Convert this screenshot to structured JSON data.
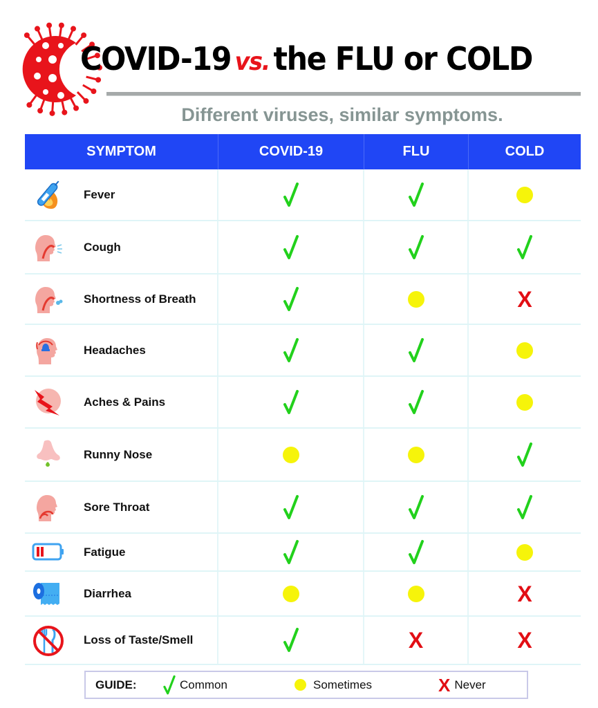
{
  "header": {
    "title_part1": "COVID-19",
    "title_vs": "vs.",
    "title_part2": "the FLU or COLD",
    "subtitle": "Different viruses, similar symptoms.",
    "logo_icon": "coronavirus-icon"
  },
  "colors": {
    "header_bg": "#2046f5",
    "common": "#22d11c",
    "sometimes": "#f6f40a",
    "never": "#e20e14",
    "virus_red": "#e8141b",
    "subtitle_gray": "#869593"
  },
  "table": {
    "columns": [
      "SYMPTOM",
      "COVID-19",
      "FLU",
      "COLD"
    ],
    "rows": [
      {
        "symptom": "Fever",
        "icon": "thermometer-fire-icon",
        "covid": "common",
        "flu": "common",
        "cold": "sometimes"
      },
      {
        "symptom": "Cough",
        "icon": "cough-head-icon",
        "covid": "common",
        "flu": "common",
        "cold": "common"
      },
      {
        "symptom": "Shortness of Breath",
        "icon": "breath-head-icon",
        "covid": "common",
        "flu": "sometimes",
        "cold": "never"
      },
      {
        "symptom": "Headaches",
        "icon": "headache-icon",
        "covid": "common",
        "flu": "common",
        "cold": "sometimes"
      },
      {
        "symptom": "Aches & Pains",
        "icon": "pain-bolt-icon",
        "covid": "common",
        "flu": "common",
        "cold": "sometimes"
      },
      {
        "symptom": "Runny Nose",
        "icon": "nose-drip-icon",
        "covid": "sometimes",
        "flu": "sometimes",
        "cold": "common"
      },
      {
        "symptom": "Sore Throat",
        "icon": "sore-throat-icon",
        "covid": "common",
        "flu": "common",
        "cold": "common"
      },
      {
        "symptom": "Fatigue",
        "icon": "low-battery-icon",
        "covid": "common",
        "flu": "common",
        "cold": "sometimes"
      },
      {
        "symptom": "Diarrhea",
        "icon": "toilet-paper-icon",
        "covid": "sometimes",
        "flu": "sometimes",
        "cold": "never"
      },
      {
        "symptom": "Loss of Taste/Smell",
        "icon": "no-eating-icon",
        "covid": "common",
        "flu": "never",
        "cold": "never"
      }
    ]
  },
  "guide": {
    "title": "GUIDE:",
    "items": [
      {
        "key": "common",
        "label": "Common",
        "icon": "check-icon"
      },
      {
        "key": "sometimes",
        "label": "Sometimes",
        "icon": "yellow-dot-icon"
      },
      {
        "key": "never",
        "label": "Never",
        "icon": "x-icon"
      }
    ],
    "never_glyph": "X"
  }
}
